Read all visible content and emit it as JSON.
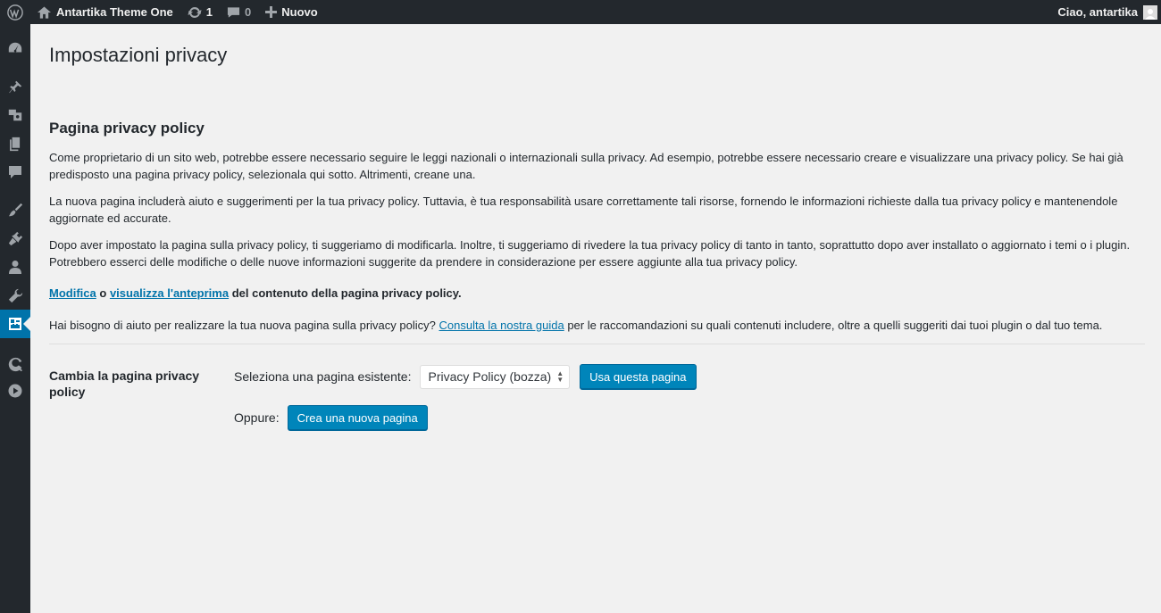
{
  "adminbar": {
    "site_name": "Antartika Theme One",
    "updates_count": "1",
    "comments_count": "0",
    "new_label": "Nuovo",
    "greeting": "Ciao, antartika"
  },
  "sidebar": {
    "icons": [
      "dashboard-icon",
      "pin-icon",
      "media-icon",
      "pages-icon",
      "comments-icon",
      "appearance-icon",
      "plugins-icon",
      "users-icon",
      "tools-icon",
      "settings-icon",
      "custom-icon",
      "play-icon"
    ],
    "active": "settings-icon"
  },
  "page": {
    "title": "Impostazioni privacy",
    "section_title": "Pagina privacy policy",
    "para1": "Come proprietario di un sito web, potrebbe essere necessario seguire le leggi nazionali o internazionali sulla privacy. Ad esempio, potrebbe essere necessario creare e visualizzare una privacy policy. Se hai già predisposto una pagina privacy policy, selezionala qui sotto. Altrimenti, creane una.",
    "para2": "La nuova pagina includerà aiuto e suggerimenti per la tua privacy policy. Tuttavia, è tua responsabilità usare correttamente tali risorse, fornendo le informazioni richieste dalla tua privacy policy e mantenendole aggiornate ed accurate.",
    "para3": "Dopo aver impostato la pagina sulla privacy policy, ti suggeriamo di modificarla. Inoltre, ti suggeriamo di rivedere la tua privacy policy di tanto in tanto, soprattutto dopo aver installato o aggiornato i temi o i plugin. Potrebbero esserci delle modifiche o delle nuove informazioni suggerite da prendere in considerazione per essere aggiunte alla tua privacy policy.",
    "edit_link": "Modifica",
    "or_word": "o",
    "preview_link": "visualizza l'anteprima",
    "actions_suffix": "del contenuto della pagina privacy policy.",
    "help_prefix": "Hai bisogno di aiuto per realizzare la tua nuova pagina sulla privacy policy?",
    "help_link": "Consulta la nostra guida",
    "help_suffix": "per le raccomandazioni su quali contenuti includere, oltre a quelli suggeriti dai tuoi plugin o dal tuo tema.",
    "form_label": "Cambia la pagina privacy policy",
    "select_label": "Seleziona una pagina esistente:",
    "select_value": "Privacy Policy (bozza)",
    "use_button": "Usa questa pagina",
    "or_label": "Oppure:",
    "create_button": "Crea una nuova pagina"
  }
}
